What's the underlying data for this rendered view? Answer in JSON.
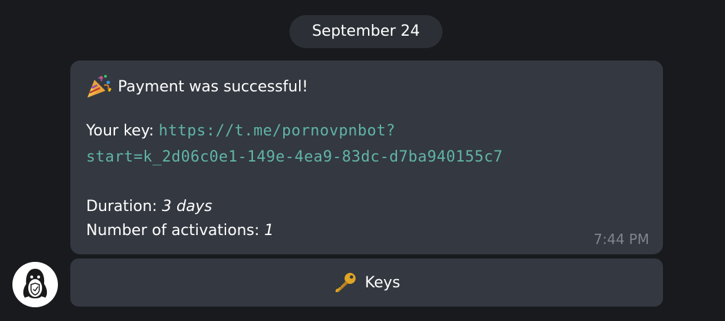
{
  "date_separator": "September 24",
  "message": {
    "title": "Payment was successful!",
    "title_icon": "party-popper-icon",
    "key_label": "Your key:",
    "key_link_part1": "https://t.me/pornovpnbot?",
    "key_link_part2": "start=k_2d06c0e1-149e-4ea9-83dc-d7ba940155c7",
    "duration_label": "Duration:",
    "duration_value": "3 days",
    "activations_label": "Number of activations:",
    "activations_value": "1",
    "time": "7:44 PM"
  },
  "keyboard": {
    "button_label": "Keys",
    "button_icon": "key-icon"
  },
  "colors": {
    "background": "#181a1e",
    "bubble": "#343840",
    "link": "#5fb5a6",
    "timestamp": "#7f858d"
  }
}
